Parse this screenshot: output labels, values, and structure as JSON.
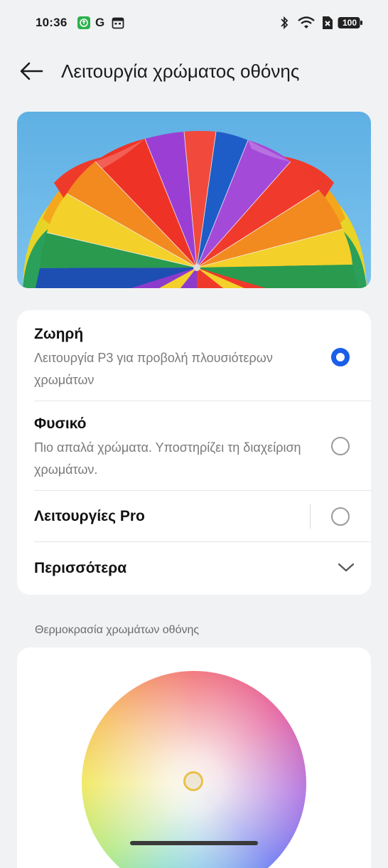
{
  "status_bar": {
    "time": "10:36",
    "icons": [
      "green-app-icon",
      "google-icon",
      "calendar-icon",
      "bluetooth-icon",
      "wifi-icon",
      "data-saver-icon"
    ],
    "battery": "100"
  },
  "header": {
    "title": "Λειτουργία χρώματος οθόνης",
    "back_icon": "arrow-left-icon"
  },
  "options": [
    {
      "title": "Ζωηρή",
      "subtitle": "Λειτουργία P3 για προβολή πλουσιότερων χρωμάτων",
      "selected": true
    },
    {
      "title": "Φυσικό",
      "subtitle": "Πιο απαλά χρώματα. Υποστηρίζει τη διαχείριση χρωμάτων.",
      "selected": false
    },
    {
      "title": "Λειτουργίες Pro",
      "selected": false
    },
    {
      "title": "Περισσότερα",
      "icon": "chevron-down-icon"
    }
  ],
  "temperature": {
    "section_label": "Θερμοκρασία χρωμάτων οθόνης"
  },
  "colors": {
    "accent": "#1b5ee8",
    "background": "#f1f2f4",
    "card": "#ffffff"
  }
}
